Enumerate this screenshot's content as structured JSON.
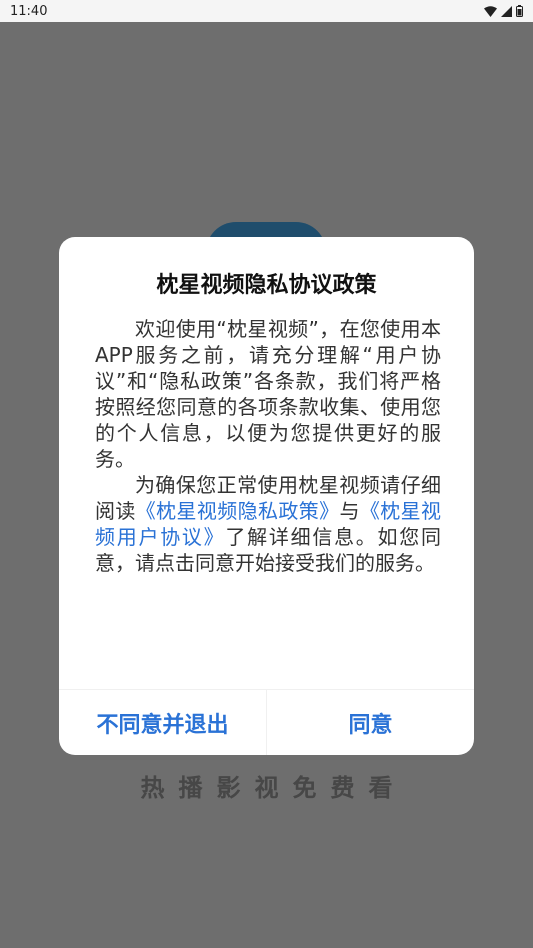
{
  "status_bar": {
    "time": "11:40"
  },
  "splash": {
    "tagline": "热播影视免费看"
  },
  "dialog": {
    "title": "枕星视频隐私协议政策",
    "para1": "欢迎使用“枕星视频”，在您使用本APP服务之前，请充分理解“用户协议”和“隐私政策”各条款，我们将严格按照经您同意的各项条款收集、使用您的个人信息，以便为您提供更好的服务。",
    "para2_prefix": "为确保您正常使用枕星视频请仔细阅读",
    "privacy_link": "《枕星视频隐私政策》",
    "para2_mid": "与",
    "agreement_link": "《枕星视频用户协议》",
    "para2_suffix": "了解详细信息。如您同意，请点击同意开始接受我们的服务。",
    "decline_label": "不同意并退出",
    "agree_label": "同意"
  },
  "colors": {
    "accent": "#2a72d6",
    "overlay": "#6e6e6e"
  }
}
